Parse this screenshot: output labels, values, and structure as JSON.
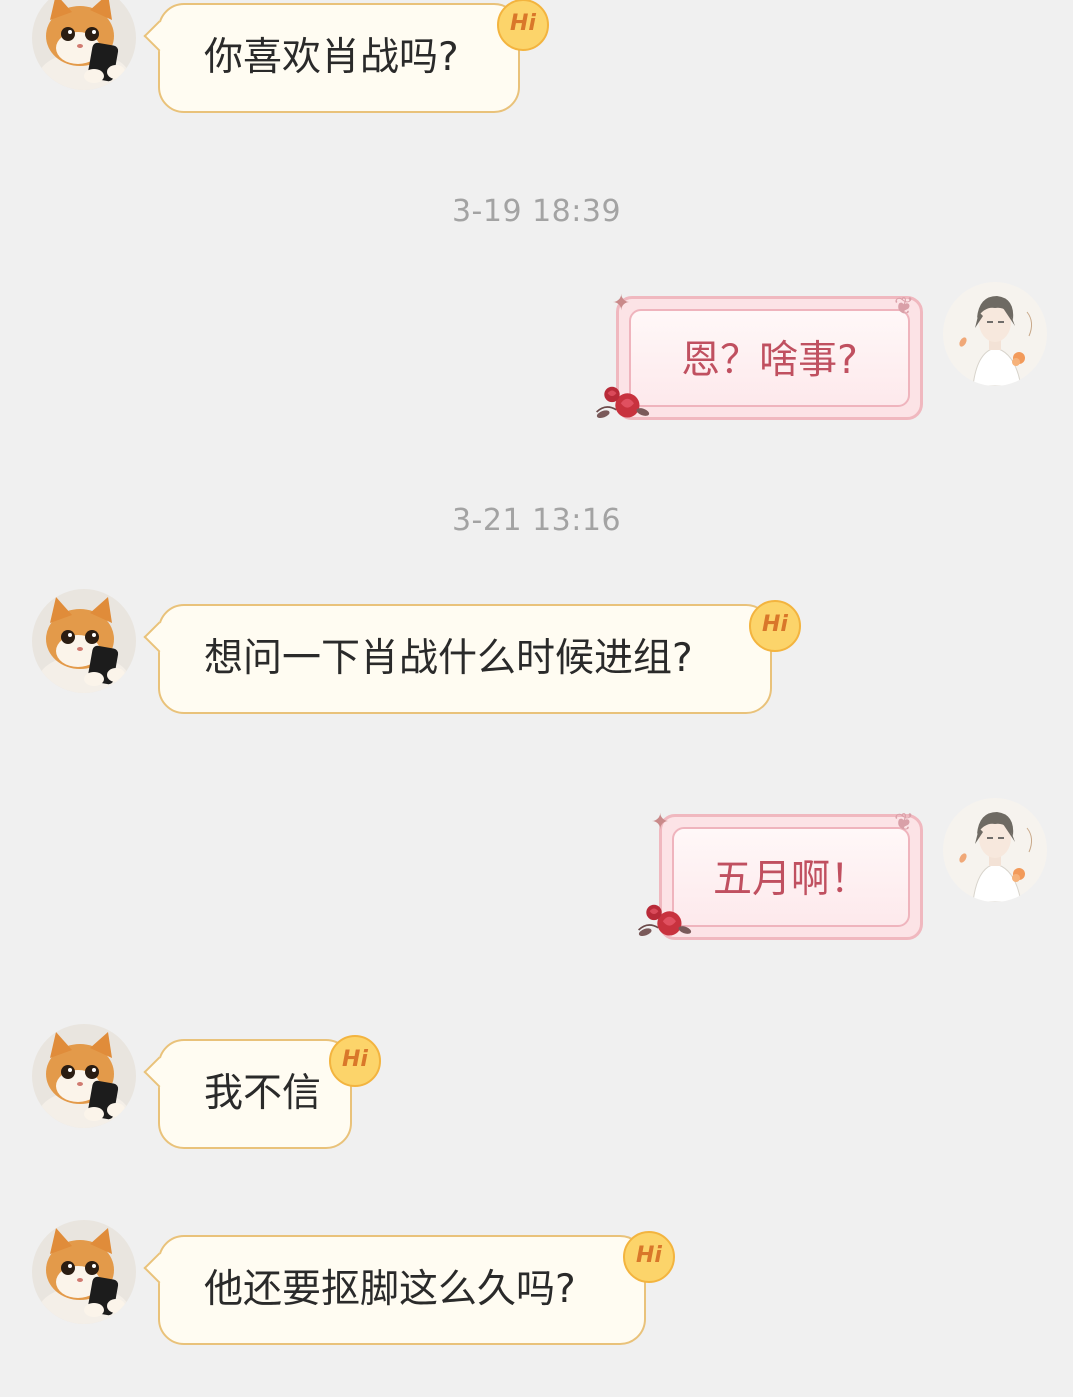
{
  "messages": [
    {
      "text": "你喜欢肖战吗?"
    },
    {
      "text": "恩？啥事?"
    },
    {
      "text": "想问一下肖战什么时候进组?"
    },
    {
      "text": "五月啊！"
    },
    {
      "text": "我不信"
    },
    {
      "text": "他还要抠脚这么久吗?"
    }
  ],
  "timestamps": [
    "3-19 18:39",
    "3-21 13:16"
  ],
  "badge_label": "Hi",
  "colors": {
    "background": "#f0f0f0",
    "incoming_bubble": "#fffcf2",
    "incoming_border": "#e9c27a",
    "outgoing_bubble": "#fde9ec",
    "outgoing_text": "#c05060",
    "badge": "#fcd46a"
  },
  "icons": {
    "incoming_avatar": "cat-avatar",
    "outgoing_avatar": "anime-boy-avatar",
    "bubble_decoration": "rose-icon",
    "badge": "hi-badge"
  }
}
